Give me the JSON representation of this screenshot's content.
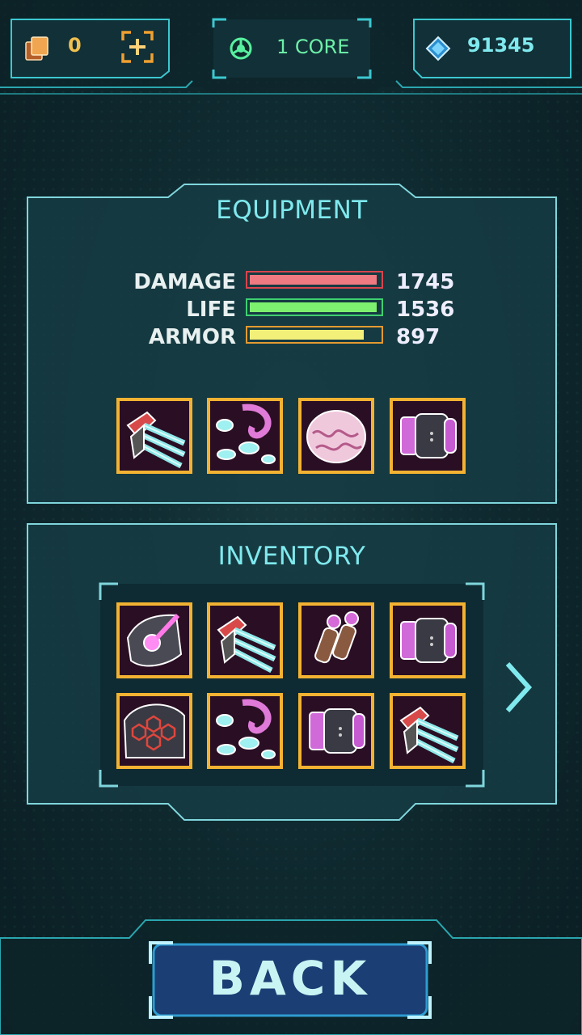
{
  "header": {
    "cards_count": "0",
    "add_icon": "plus-frame-icon",
    "core_label": "1 CORE",
    "core_icon": "core-icon",
    "gems_count": "91345",
    "gem_icon": "diamond-icon"
  },
  "equipment": {
    "title": "EQUIPMENT",
    "stats": [
      {
        "label": "DAMAGE",
        "value": "1745",
        "fill": 0.98,
        "color": "#f07a82",
        "border": "#d9444e"
      },
      {
        "label": "LIFE",
        "value": "1536",
        "fill": 0.98,
        "color": "#7ef070",
        "border": "#3ed070"
      },
      {
        "label": "ARMOR",
        "value": "897",
        "fill": 0.88,
        "color": "#f3f07a",
        "border": "#e49a30"
      }
    ],
    "slots": [
      "blaster-part-icon",
      "tentacle-part-icon",
      "brain-core-icon",
      "cannon-part-icon"
    ]
  },
  "inventory": {
    "title": "INVENTORY",
    "items": [
      "energy-orb-part-icon",
      "blaster-part-icon",
      "twin-barrel-part-icon",
      "cannon-part-icon",
      "hex-shell-part-icon",
      "tentacle-part-icon",
      "cannon-part-icon",
      "blaster-part-icon"
    ],
    "next_icon": "chevron-right-icon"
  },
  "footer": {
    "back_label": "BACK"
  },
  "colors": {
    "accent": "#7fe9ee",
    "slot_border": "#f3b232",
    "panel_fill": "#163c44"
  }
}
